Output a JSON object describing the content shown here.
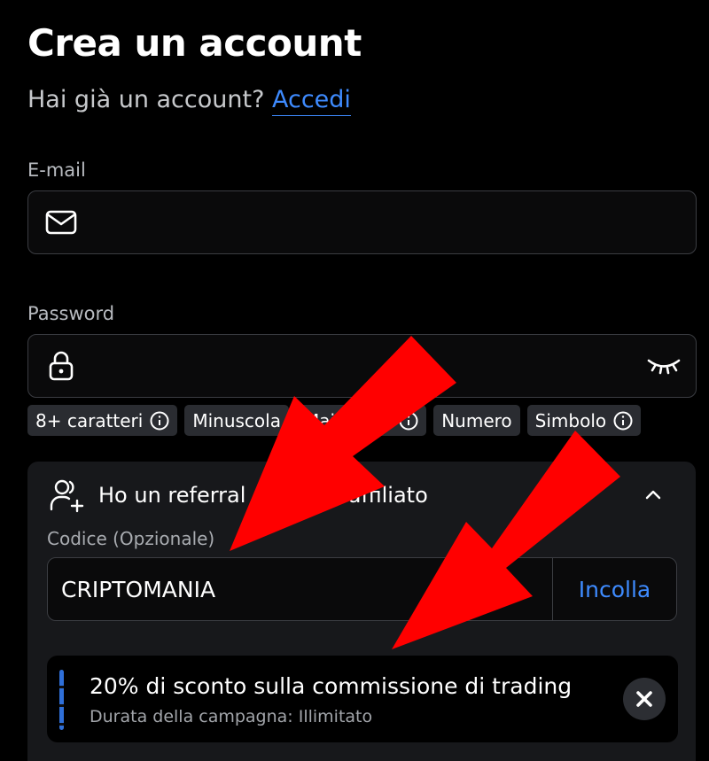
{
  "header": {
    "title": "Crea un account",
    "have_account_text": "Hai già un account?",
    "login_link": "Accedi"
  },
  "email": {
    "label": "E-mail",
    "icon": "mail-icon",
    "value": ""
  },
  "password": {
    "label": "Password",
    "icon": "lock-icon",
    "toggle_icon": "eye-closed-icon",
    "value": ""
  },
  "requirements": [
    {
      "label": "8+ caratteri",
      "has_info": true
    },
    {
      "label": "Minuscola",
      "has_info": false
    },
    {
      "label": "Maiuscola",
      "has_info": true
    },
    {
      "label": "Numero",
      "has_info": false
    },
    {
      "label": "Simbolo",
      "has_info": true
    }
  ],
  "referral": {
    "title": "Ho un referral o codice affiliato",
    "icon": "person-add-icon",
    "expanded": true,
    "code_label": "Codice (Opzionale)",
    "code_value": "CRIPTOMANIA",
    "paste_label": "Incolla"
  },
  "promo": {
    "title": "20% di sconto sulla commissione di trading",
    "subtitle": "Durata della campagna: Illimitato"
  },
  "colors": {
    "background": "#000000",
    "accent": "#3e8bff",
    "panel": "#17181b",
    "arrow": "#ff0000"
  }
}
